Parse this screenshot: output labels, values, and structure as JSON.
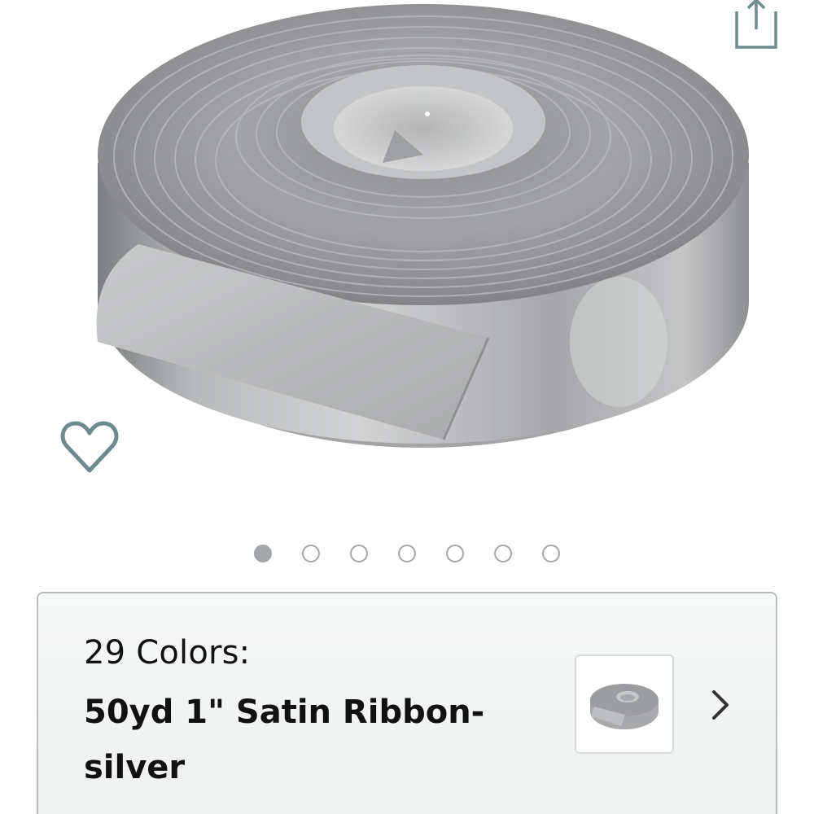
{
  "product": {
    "image_alt": "Silver satin ribbon spool",
    "image_count": 7,
    "active_image_index": 0
  },
  "icons": {
    "share": "share-icon",
    "wishlist": "heart-icon",
    "chevron": "chevron-right-icon"
  },
  "variation": {
    "count_label": "29 Colors:",
    "selected_name": "50yd 1\" Satin Ribbon-silver"
  },
  "colors": {
    "ribbon_base": "#9a9b9d",
    "icon_teal": "#6f8a8c",
    "dot_gray": "#a4a8ab",
    "card_border": "#b8bdbe"
  }
}
